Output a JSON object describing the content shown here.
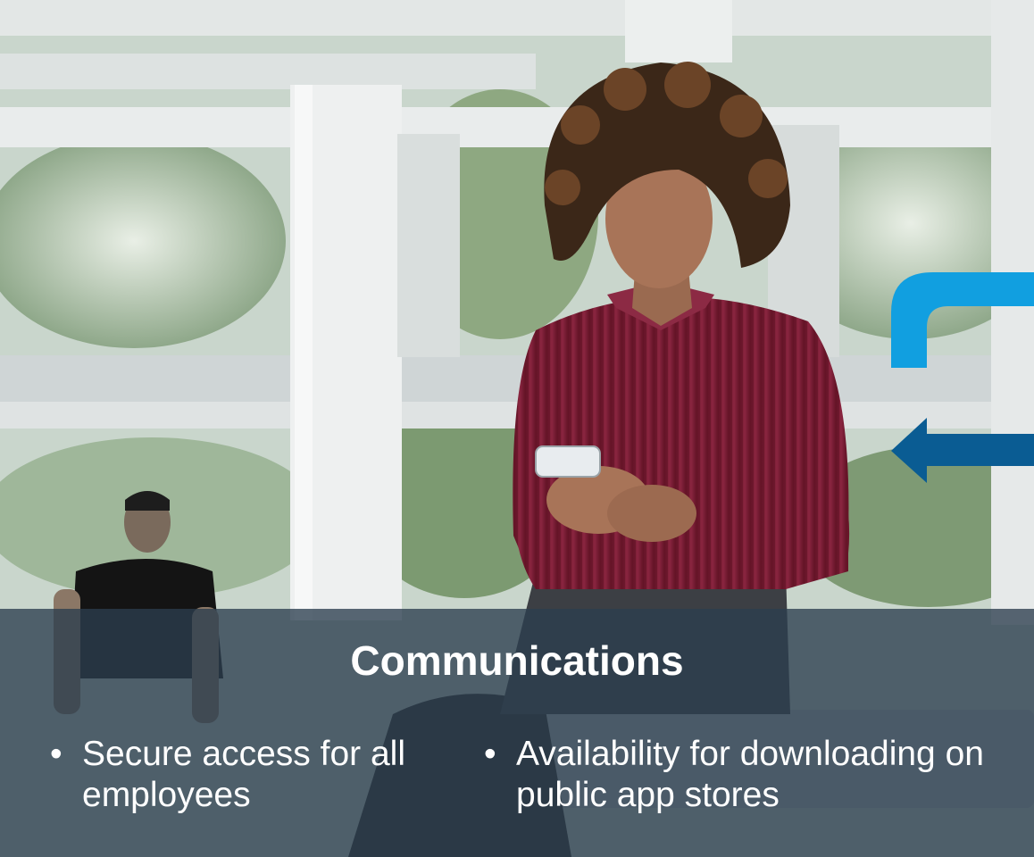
{
  "slide": {
    "title": "Communications",
    "bullets": [
      {
        "text": "Secure access for all employees"
      },
      {
        "text": "Availability for downloading on public app stores"
      }
    ],
    "bullet_glyph": "•",
    "colors": {
      "overlay": "#2c3e4e",
      "accent_light_blue": "#119fe0",
      "accent_dark_blue": "#0a5c93",
      "shirt": "#7d1e34",
      "text": "#ffffff"
    },
    "icons": [
      "corner-arrow-icon",
      "left-arrow-icon"
    ]
  }
}
